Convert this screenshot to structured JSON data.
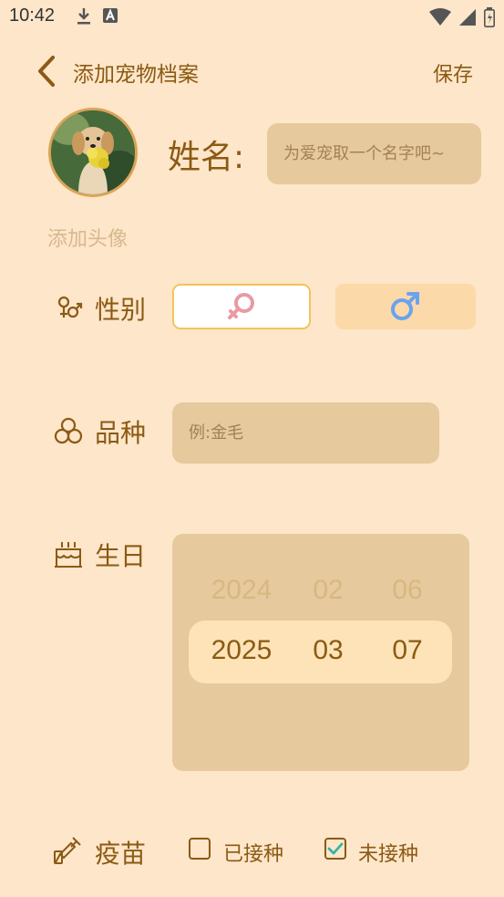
{
  "status_bar": {
    "time": "10:42",
    "icons": [
      "download-icon",
      "app-notification-icon",
      "wifi-icon",
      "signal-icon",
      "battery-icon"
    ]
  },
  "header": {
    "title": "添加宠物档案",
    "save_label": "保存"
  },
  "avatar": {
    "add_label": "添加头像"
  },
  "name": {
    "label": "姓名:",
    "placeholder": "为爱宠取一个名字吧~"
  },
  "gender": {
    "label": "性别",
    "female_symbol": "♀",
    "male_symbol": "♂",
    "female_color": "#e99aa3",
    "male_color": "#6aa3ee"
  },
  "breed": {
    "label": "品种",
    "placeholder": "例:金毛"
  },
  "birthday": {
    "label": "生日",
    "previous": {
      "year": "2024",
      "month": "02",
      "day": "06"
    },
    "selected": {
      "year": "2025",
      "month": "03",
      "day": "07"
    }
  },
  "vaccine": {
    "label": "疫苗",
    "options": [
      {
        "label": "已接种",
        "checked": false
      },
      {
        "label": "未接种",
        "checked": true
      }
    ],
    "check_color": "#35b5a2"
  },
  "colors": {
    "background": "#fde6c9",
    "primary_text": "#8b5a14",
    "input_bg": "#e6c99d"
  }
}
